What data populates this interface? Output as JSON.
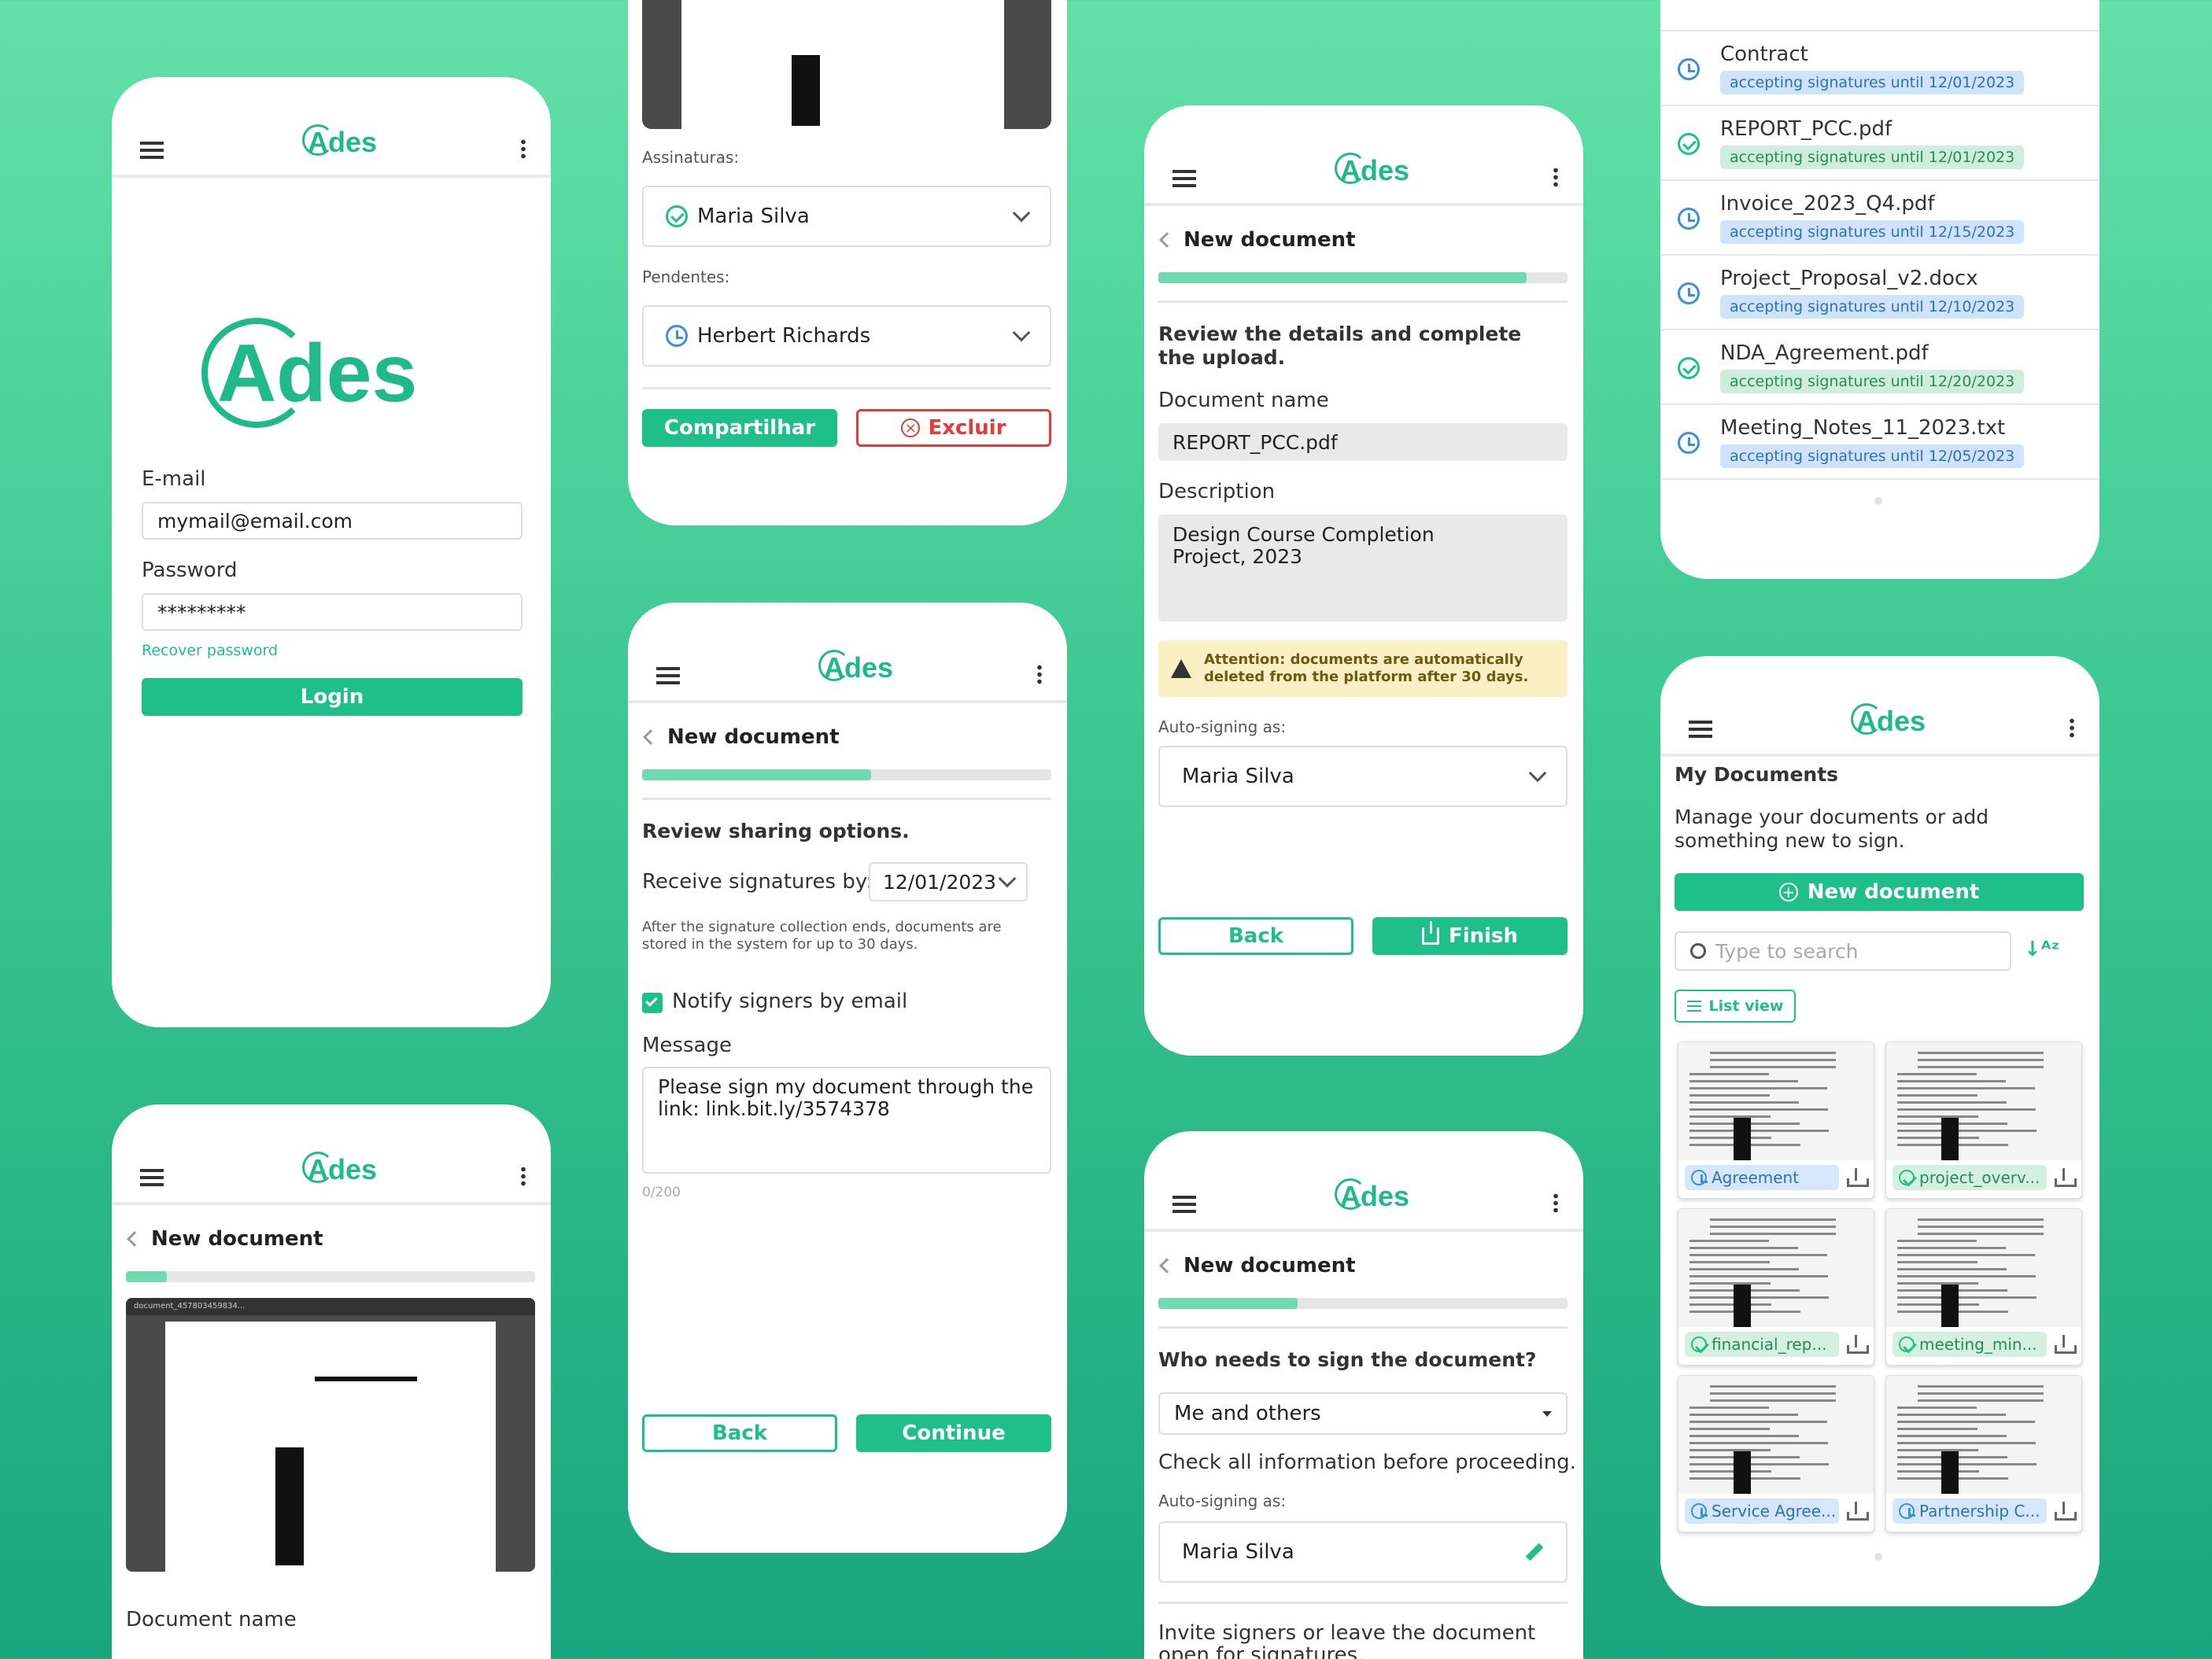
{
  "brand": "Ades",
  "login": {
    "email_label": "E-mail",
    "email_value": "mymail@email.com",
    "password_label": "Password",
    "password_value": "*********",
    "recover": "Recover password",
    "login_btn": "Login"
  },
  "signatures": {
    "signed_label": "Assinaturas:",
    "signed_name": "Maria Silva",
    "pending_label": "Pendentes:",
    "pending_name": "Herbert Richards",
    "share_btn": "Compartilhar",
    "delete_btn": "Excluir"
  },
  "sharing": {
    "back": "New document",
    "heading": "Review sharing options.",
    "receive_label": "Receive signatures by:",
    "receive_date": "12/01/2023",
    "note": "After the signature collection ends, documents are stored in the system for up to 30 days.",
    "notify": "Notify signers by email",
    "message_label": "Message",
    "message": "Please sign my document through the link: link.bit.ly/3574378",
    "counter": "0/200",
    "back_btn": "Back",
    "continue_btn": "Continue",
    "progress": 0.56
  },
  "upload": {
    "back": "New document",
    "doc_name_label": "Document name",
    "progress": 0.1,
    "preview_title": "document_457803459834..."
  },
  "review": {
    "back": "New document",
    "heading": "Review the details and complete the upload.",
    "doc_name_label": "Document name",
    "doc_name": "REPORT_PCC.pdf",
    "desc_label": "Description",
    "desc": "Design Course Completion Project, 2023",
    "warning": "Attention: documents are automatically deleted from the platform after 30 days.",
    "autosign_label": "Auto-signing as:",
    "autosign": "Maria Silva",
    "back_btn": "Back",
    "finish_btn": "Finish",
    "progress": 0.9
  },
  "signers": {
    "back": "New document",
    "heading": "Who needs to sign the document?",
    "who": "Me and others",
    "check": "Check all information before proceeding.",
    "autosign_label": "Auto-signing as:",
    "autosign": "Maria Silva",
    "invite": "Invite signers or leave the document open for signatures.",
    "progress": 0.34
  },
  "list": {
    "items": [
      {
        "name": "Contract",
        "status": "accepting signatures until 12/01/2023",
        "state": "pending"
      },
      {
        "name": "REPORT_PCC.pdf",
        "status": "accepting signatures until 12/01/2023",
        "state": "done"
      },
      {
        "name": "Invoice_2023_Q4.pdf",
        "status": "accepting signatures until 12/15/2023",
        "state": "pending"
      },
      {
        "name": "Project_Proposal_v2.docx",
        "status": "accepting signatures until 12/10/2023",
        "state": "pending"
      },
      {
        "name": "NDA_Agreement.pdf",
        "status": "accepting signatures until 12/20/2023",
        "state": "done"
      },
      {
        "name": "Meeting_Notes_11_2023.txt",
        "status": "accepting signatures until 12/05/2023",
        "state": "pending"
      }
    ]
  },
  "mydocs": {
    "title": "My Documents",
    "subtitle": "Manage your documents or add something new to sign.",
    "new_btn": "New document",
    "search_placeholder": "Type to search",
    "list_view": "List view",
    "cards": [
      {
        "name": "Agreement",
        "state": "pending"
      },
      {
        "name": "project_overv...",
        "state": "done"
      },
      {
        "name": "financial_rep...",
        "state": "done"
      },
      {
        "name": "meeting_min...",
        "state": "done"
      },
      {
        "name": "Service Agree...",
        "state": "pending"
      },
      {
        "name": "Partnership C...",
        "state": "pending"
      }
    ]
  },
  "colors": {
    "accent": "#1fbf8a",
    "pending": "#3b8fe0",
    "danger": "#e23b3b",
    "warning_bg": "#fbf0c4"
  }
}
